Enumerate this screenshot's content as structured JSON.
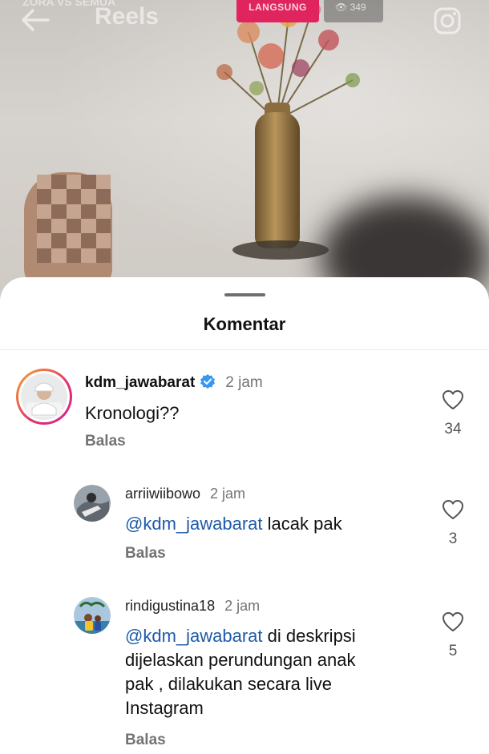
{
  "video": {
    "header_title": "Reels",
    "overlay_text": "ZORA VS SEMUA",
    "live_label": "LANGSUNG",
    "viewer_count": "349"
  },
  "sheet": {
    "title": "Komentar"
  },
  "comments": [
    {
      "username": "kdm_jawabarat",
      "verified": true,
      "time": "2 jam",
      "text": "Kronologi??",
      "reply_label": "Balas",
      "likes": "34"
    },
    {
      "username": "arriiwiibowo",
      "time": "2 jam",
      "mention": "@kdm_jawabarat",
      "text": " lacak pak",
      "reply_label": "Balas",
      "likes": "3"
    },
    {
      "username": "rindigustina18",
      "time": "2 jam",
      "mention": "@kdm_jawabarat",
      "text_lines": [
        " di deskripsi",
        "dijelaskan perundungan anak",
        "pak , dilakukan secara live",
        "Instagram"
      ],
      "reply_label": "Balas",
      "likes": "5"
    }
  ],
  "colors": {
    "live_badge": "#e0245e",
    "mention": "#1e5aa8",
    "verified": "#3897f0",
    "story_ring_start": "#f9a825",
    "story_ring_end": "#d6249f"
  }
}
